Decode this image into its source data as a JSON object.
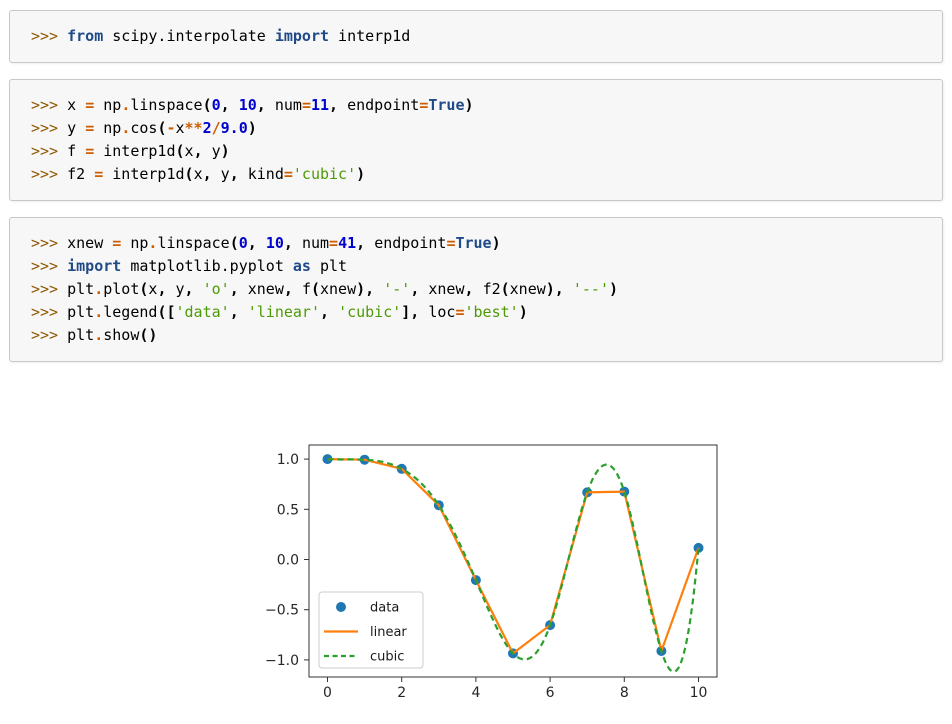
{
  "syntax_colors": {
    "prompt": "#8f5902",
    "keyword": "#204a87",
    "operator": "#ce5c00",
    "number": "#0000cf",
    "string": "#4e9a06",
    "punctuation": "#000000",
    "name": "#000000",
    "block_background": "#f7f7f7",
    "block_border": "#c8c8c8"
  },
  "code_blocks": [
    {
      "name": "import-interp1d",
      "lines": [
        [
          [
            "p",
            ">>> "
          ],
          [
            "k",
            "from"
          ],
          [
            "n",
            " scipy.interpolate "
          ],
          [
            "k",
            "import"
          ],
          [
            "n",
            " interp1d"
          ]
        ]
      ]
    },
    {
      "name": "build-interpolators",
      "lines": [
        [
          [
            "p",
            ">>> "
          ],
          [
            "n",
            "x "
          ],
          [
            "o",
            "="
          ],
          [
            "n",
            " np"
          ],
          [
            "o",
            "."
          ],
          [
            "n",
            "linspace"
          ],
          [
            "x",
            "("
          ],
          [
            "m",
            "0"
          ],
          [
            "x",
            ", "
          ],
          [
            "m",
            "10"
          ],
          [
            "x",
            ", "
          ],
          [
            "n",
            "num"
          ],
          [
            "o",
            "="
          ],
          [
            "m",
            "11"
          ],
          [
            "x",
            ", "
          ],
          [
            "n",
            "endpoint"
          ],
          [
            "o",
            "="
          ],
          [
            "k",
            "True"
          ],
          [
            "x",
            ")"
          ]
        ],
        [
          [
            "p",
            ">>> "
          ],
          [
            "n",
            "y "
          ],
          [
            "o",
            "="
          ],
          [
            "n",
            " np"
          ],
          [
            "o",
            "."
          ],
          [
            "n",
            "cos"
          ],
          [
            "x",
            "("
          ],
          [
            "o",
            "-"
          ],
          [
            "n",
            "x"
          ],
          [
            "o",
            "**"
          ],
          [
            "m",
            "2"
          ],
          [
            "o",
            "/"
          ],
          [
            "m",
            "9.0"
          ],
          [
            "x",
            ")"
          ]
        ],
        [
          [
            "p",
            ">>> "
          ],
          [
            "n",
            "f "
          ],
          [
            "o",
            "="
          ],
          [
            "n",
            " interp1d"
          ],
          [
            "x",
            "("
          ],
          [
            "n",
            "x"
          ],
          [
            "x",
            ", "
          ],
          [
            "n",
            "y"
          ],
          [
            "x",
            ")"
          ]
        ],
        [
          [
            "p",
            ">>> "
          ],
          [
            "n",
            "f2 "
          ],
          [
            "o",
            "="
          ],
          [
            "n",
            " interp1d"
          ],
          [
            "x",
            "("
          ],
          [
            "n",
            "x"
          ],
          [
            "x",
            ", "
          ],
          [
            "n",
            "y"
          ],
          [
            "x",
            ", "
          ],
          [
            "n",
            "kind"
          ],
          [
            "o",
            "="
          ],
          [
            "s",
            "'cubic'"
          ],
          [
            "x",
            ")"
          ]
        ]
      ]
    },
    {
      "name": "plot-commands",
      "lines": [
        [
          [
            "p",
            ">>> "
          ],
          [
            "n",
            "xnew "
          ],
          [
            "o",
            "="
          ],
          [
            "n",
            " np"
          ],
          [
            "o",
            "."
          ],
          [
            "n",
            "linspace"
          ],
          [
            "x",
            "("
          ],
          [
            "m",
            "0"
          ],
          [
            "x",
            ", "
          ],
          [
            "m",
            "10"
          ],
          [
            "x",
            ", "
          ],
          [
            "n",
            "num"
          ],
          [
            "o",
            "="
          ],
          [
            "m",
            "41"
          ],
          [
            "x",
            ", "
          ],
          [
            "n",
            "endpoint"
          ],
          [
            "o",
            "="
          ],
          [
            "k",
            "True"
          ],
          [
            "x",
            ")"
          ]
        ],
        [
          [
            "p",
            ">>> "
          ],
          [
            "k",
            "import"
          ],
          [
            "n",
            " matplotlib.pyplot "
          ],
          [
            "k",
            "as"
          ],
          [
            "n",
            " plt"
          ]
        ],
        [
          [
            "p",
            ">>> "
          ],
          [
            "n",
            "plt"
          ],
          [
            "o",
            "."
          ],
          [
            "n",
            "plot"
          ],
          [
            "x",
            "("
          ],
          [
            "n",
            "x"
          ],
          [
            "x",
            ", "
          ],
          [
            "n",
            "y"
          ],
          [
            "x",
            ", "
          ],
          [
            "s",
            "'o'"
          ],
          [
            "x",
            ", "
          ],
          [
            "n",
            "xnew"
          ],
          [
            "x",
            ", "
          ],
          [
            "n",
            "f"
          ],
          [
            "x",
            "("
          ],
          [
            "n",
            "xnew"
          ],
          [
            "x",
            "), "
          ],
          [
            "s",
            "'-'"
          ],
          [
            "x",
            ", "
          ],
          [
            "n",
            "xnew"
          ],
          [
            "x",
            ", "
          ],
          [
            "n",
            "f2"
          ],
          [
            "x",
            "("
          ],
          [
            "n",
            "xnew"
          ],
          [
            "x",
            "), "
          ],
          [
            "s",
            "'--'"
          ],
          [
            "x",
            ")"
          ]
        ],
        [
          [
            "p",
            ">>> "
          ],
          [
            "n",
            "plt"
          ],
          [
            "o",
            "."
          ],
          [
            "n",
            "legend"
          ],
          [
            "x",
            "(["
          ],
          [
            "s",
            "'data'"
          ],
          [
            "x",
            ", "
          ],
          [
            "s",
            "'linear'"
          ],
          [
            "x",
            ", "
          ],
          [
            "s",
            "'cubic'"
          ],
          [
            "x",
            "], "
          ],
          [
            "n",
            "loc"
          ],
          [
            "o",
            "="
          ],
          [
            "s",
            "'best'"
          ],
          [
            "x",
            ")"
          ]
        ],
        [
          [
            "p",
            ">>> "
          ],
          [
            "n",
            "plt"
          ],
          [
            "o",
            "."
          ],
          [
            "n",
            "show"
          ],
          [
            "x",
            "()"
          ]
        ]
      ]
    }
  ],
  "chart_data": {
    "type": "line",
    "title": "",
    "xlabel": "",
    "ylabel": "",
    "x": [
      0,
      1,
      2,
      3,
      4,
      5,
      6,
      7,
      8,
      9,
      10
    ],
    "series": [
      {
        "name": "data",
        "plot": "scatter",
        "marker": "circle",
        "color": "#1f77b4",
        "y": [
          1.0,
          0.99383,
          0.90285,
          0.5403,
          -0.20551,
          -0.93455,
          -0.65364,
          0.6683,
          0.67643,
          -0.91113,
          0.11528
        ]
      },
      {
        "name": "linear",
        "plot": "line",
        "linestyle": "solid",
        "color": "#ff7f0e",
        "interpolation": "linear"
      },
      {
        "name": "cubic",
        "plot": "line",
        "linestyle": "dashed",
        "color": "#2ca02c",
        "interpolation": "cubic"
      }
    ],
    "xticks": {
      "values": [
        0,
        2,
        4,
        6,
        8,
        10
      ],
      "labels": [
        "0",
        "2",
        "4",
        "6",
        "8",
        "10"
      ]
    },
    "yticks": {
      "values": [
        1.0,
        0.5,
        0.0,
        -0.5,
        -1.0
      ],
      "labels": [
        "1.0",
        "0.5",
        "0.0",
        "−0.5",
        "−1.0"
      ]
    },
    "xlim": [
      -0.5,
      10.5
    ],
    "ylim": [
      -1.17,
      1.14
    ],
    "grid": false,
    "frame_color": "#333333",
    "tick_label_color": "#262626",
    "legend": {
      "location": "lower left",
      "entries": [
        "data",
        "linear",
        "cubic"
      ],
      "border_color": "#cccccc",
      "text_color": "#1a1a1a"
    }
  }
}
